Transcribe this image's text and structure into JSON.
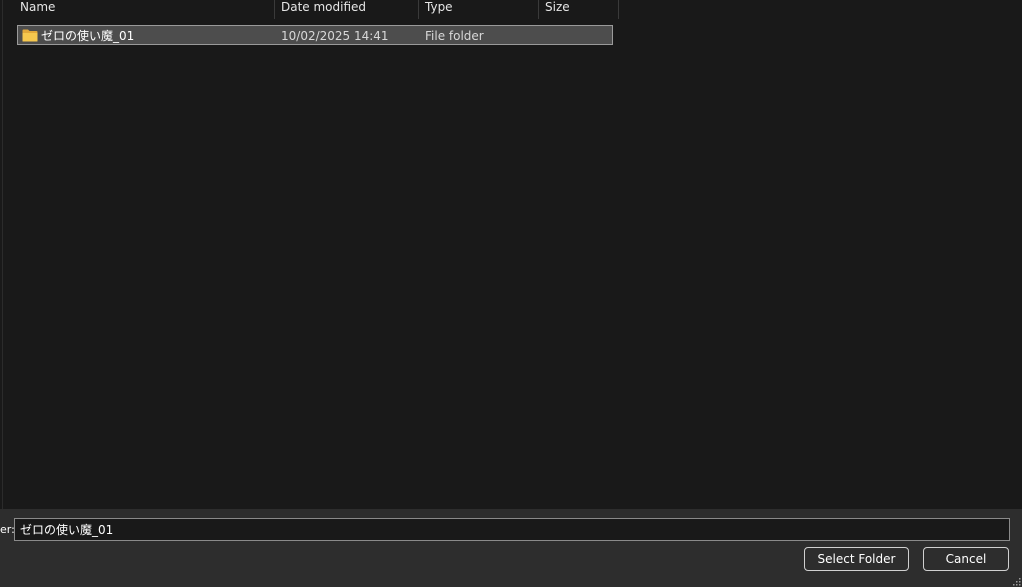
{
  "columns": {
    "name": "Name",
    "date_modified": "Date modified",
    "type": "Type",
    "size": "Size"
  },
  "files": [
    {
      "name": "ゼロの使い魔_01",
      "date_modified": "10/02/2025 14:41",
      "type": "File folder",
      "size": "",
      "icon": "folder-icon",
      "selected": true
    }
  ],
  "footer": {
    "folder_label": "er:",
    "folder_value": "ゼロの使い魔_01",
    "select_button": "Select Folder",
    "cancel_button": "Cancel"
  },
  "colors": {
    "background": "#191919",
    "footer": "#2d2d2d",
    "selection": "#4d4d4d",
    "folder": "#f6c84e"
  }
}
